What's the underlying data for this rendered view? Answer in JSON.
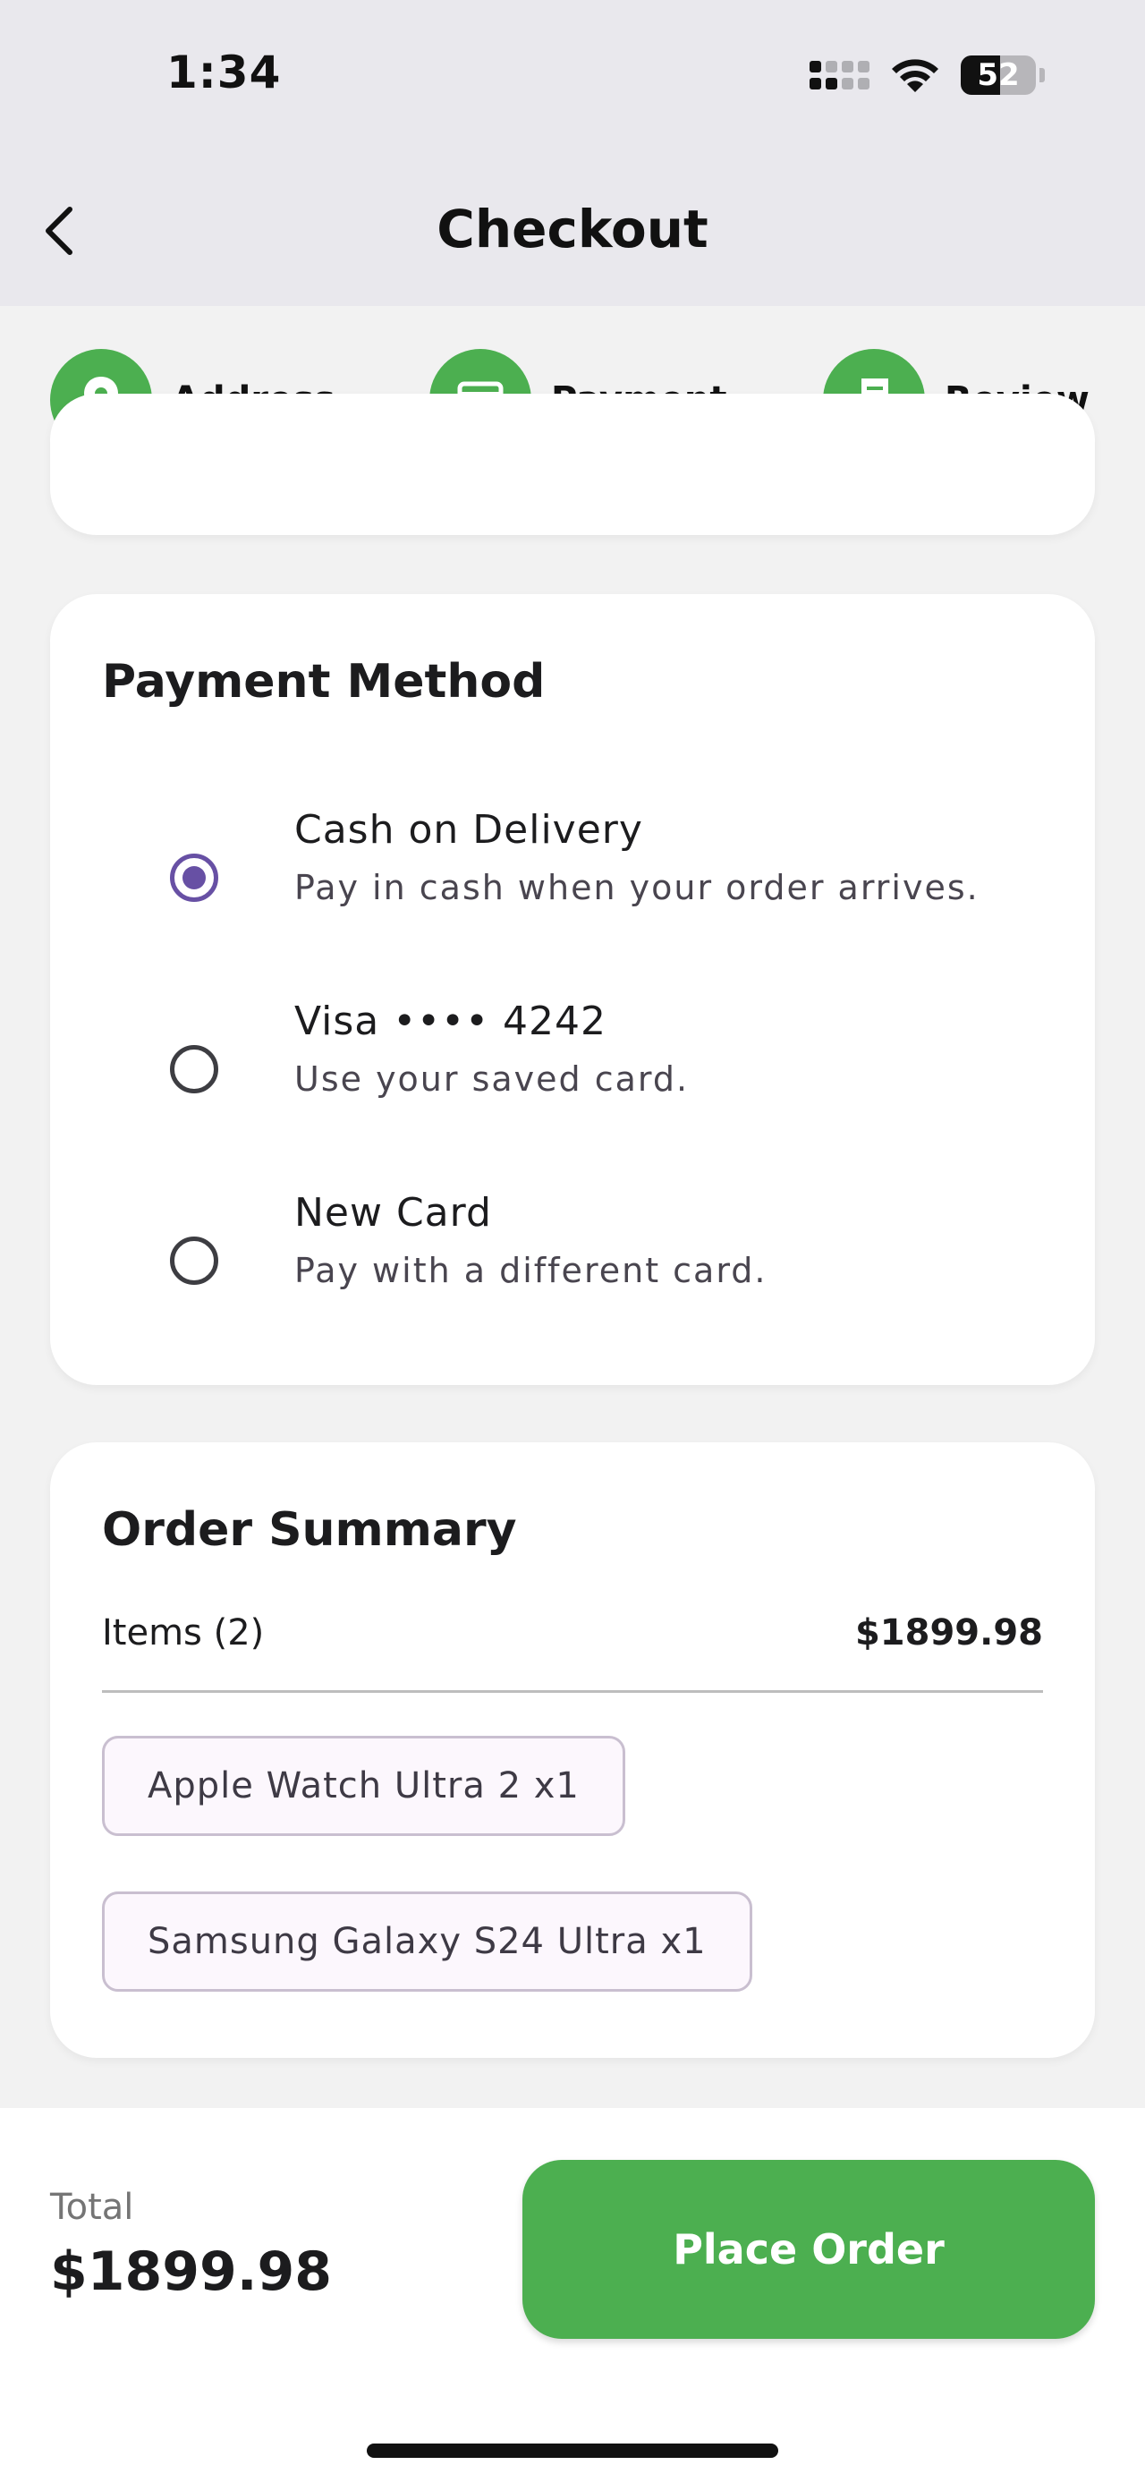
{
  "status_bar": {
    "time": "1:34",
    "battery": "52",
    "icons": [
      "signal-icon",
      "wifi-icon",
      "battery-icon"
    ]
  },
  "nav": {
    "title": "Checkout",
    "back_icon": "chevron-left-icon"
  },
  "stepper": {
    "steps": [
      {
        "label": "Address",
        "icon": "location-pin-icon"
      },
      {
        "label": "Payment",
        "icon": "credit-card-icon"
      },
      {
        "label": "Review",
        "icon": "receipt-icon"
      }
    ],
    "color": "#4CAF50"
  },
  "payment_method": {
    "title": "Payment Method",
    "options": [
      {
        "title": "Cash on Delivery",
        "subtitle": "Pay in cash when your order arrives.",
        "selected": true
      },
      {
        "title": "Visa •••• 4242",
        "subtitle": "Use your saved card.",
        "selected": false
      },
      {
        "title": "New Card",
        "subtitle": "Pay with a different card.",
        "selected": false
      }
    ],
    "accent": "#6750A4"
  },
  "order_summary": {
    "title": "Order Summary",
    "items_label": "Items (2)",
    "items_total": "$1899.98",
    "items": [
      "Apple Watch Ultra 2 x1",
      "Samsung Galaxy S24 Ultra x1"
    ]
  },
  "bottom_bar": {
    "total_label": "Total",
    "total_value": "$1899.98",
    "place_order_label": "Place Order"
  }
}
